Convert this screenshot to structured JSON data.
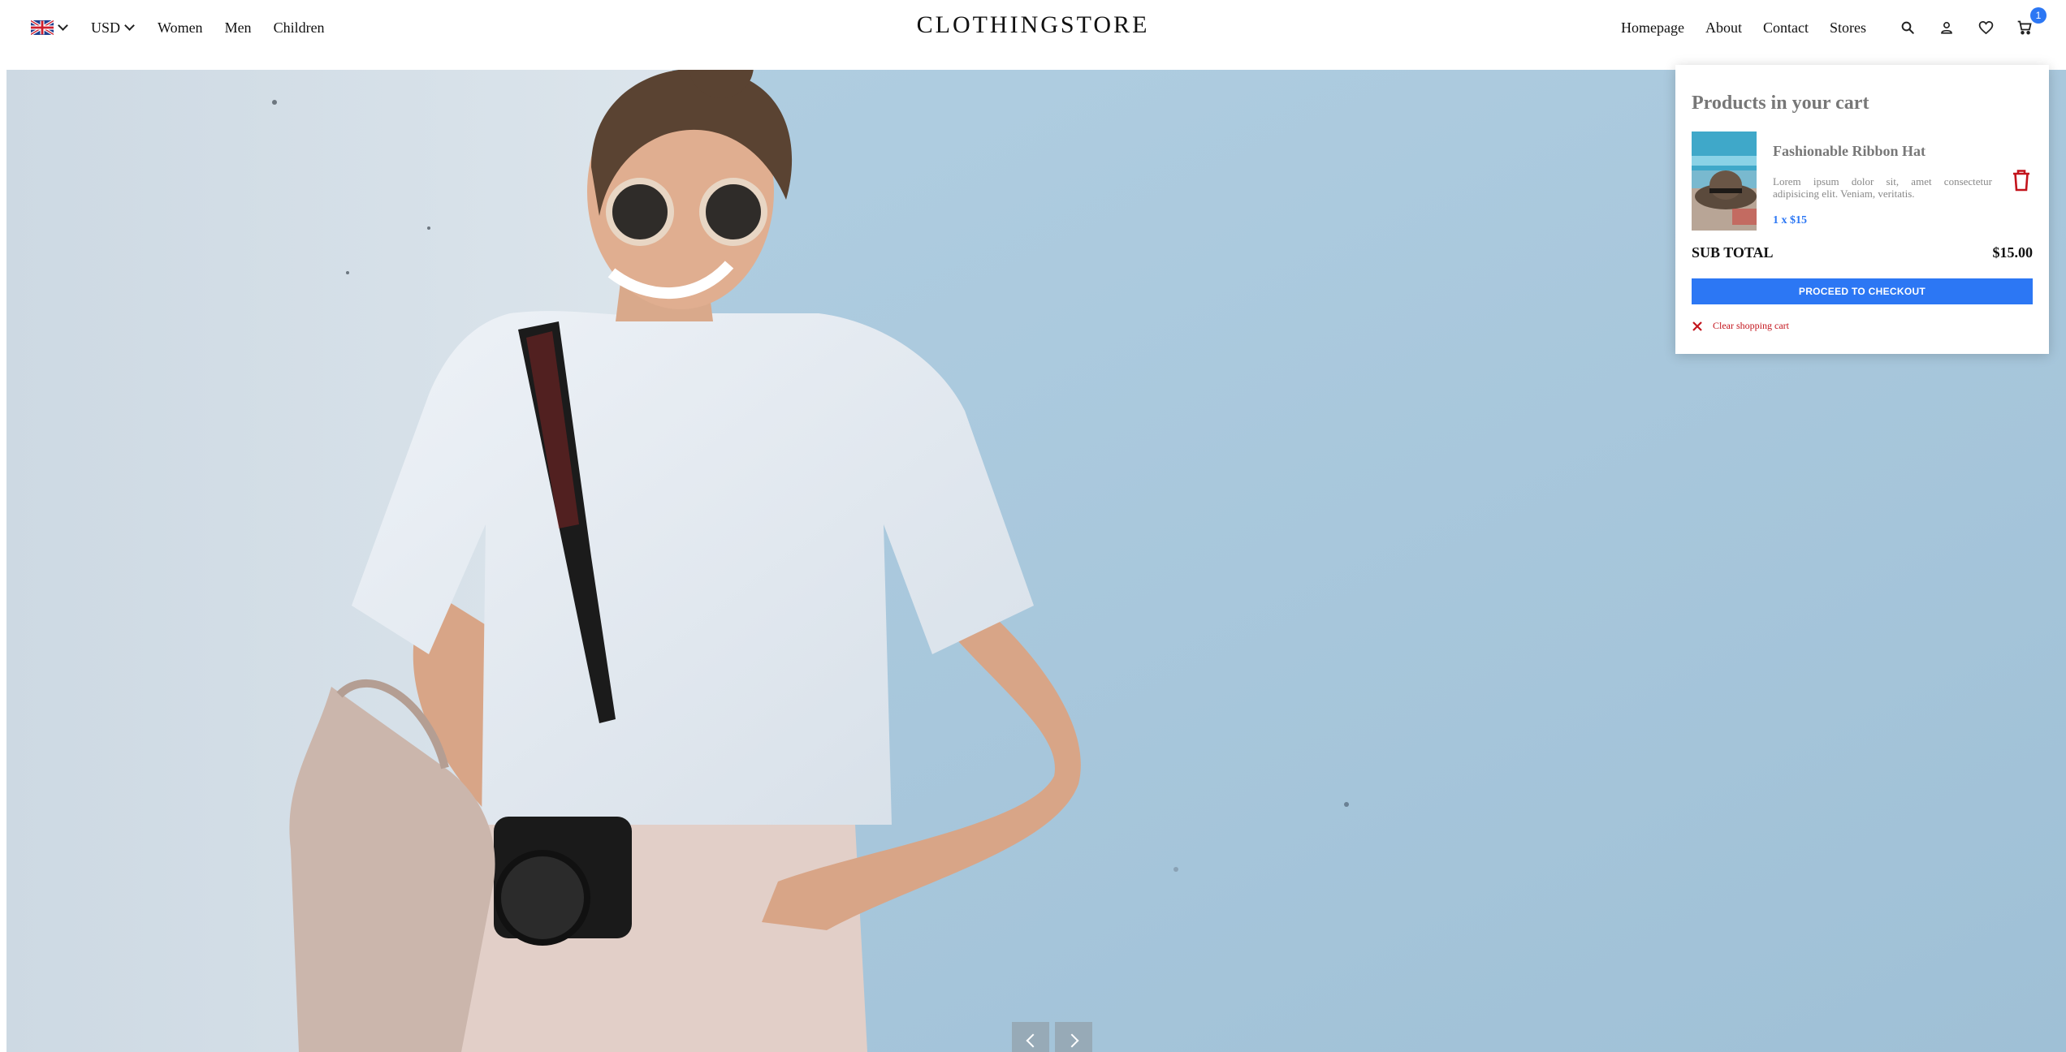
{
  "header": {
    "language_icon": "uk-flag-icon",
    "currency": "USD",
    "left_links": [
      "Women",
      "Men",
      "Children"
    ],
    "brand": "CLOTHINGSTORE",
    "right_links": [
      "Homepage",
      "About",
      "Contact",
      "Stores"
    ],
    "icons": [
      "search-icon",
      "user-icon",
      "heart-icon",
      "cart-icon"
    ],
    "cart_count": "1"
  },
  "hero": {
    "image": "woman-with-camera-photo",
    "prev_icon": "chevron-left-icon",
    "next_icon": "chevron-right-icon"
  },
  "cart": {
    "title": "Products in your cart",
    "items": [
      {
        "name": "Fashionable Ribbon Hat",
        "description": "Lorem ipsum dolor sit, amet consectetur adipisicing elit. Veniam, veritatis.",
        "quantity_price": "1 x $15",
        "image": "hat-product-thumbnail"
      }
    ],
    "subtotal_label": "SUB TOTAL",
    "subtotal_value": "$15.00",
    "checkout_label": "PROCEED TO CHECKOUT",
    "clear_label": "Clear shopping cart"
  },
  "colors": {
    "accent": "#2c77f4",
    "danger": "#c3141c",
    "hero_wall": "#a9c8dd"
  }
}
